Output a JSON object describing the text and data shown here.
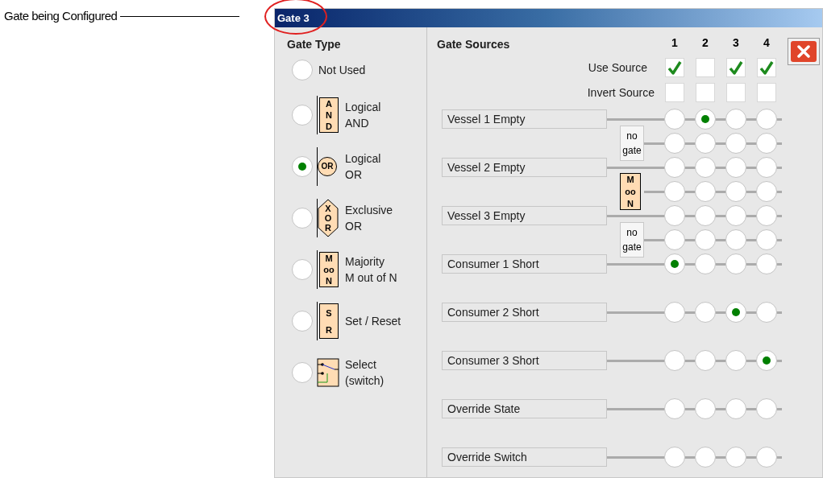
{
  "annotation": {
    "label": "Gate being Configured"
  },
  "window": {
    "title": "Gate 3"
  },
  "gate_type": {
    "heading": "Gate Type",
    "options": [
      {
        "label_lines": [
          "Not Used"
        ],
        "kind": "none",
        "selected": false
      },
      {
        "label_lines": [
          "Logical",
          "AND"
        ],
        "kind": "box",
        "symbol_lines": [
          "A",
          "N",
          "D"
        ],
        "selected": false
      },
      {
        "label_lines": [
          "Logical",
          "OR"
        ],
        "kind": "circle",
        "symbol_lines": [
          "OR"
        ],
        "selected": true
      },
      {
        "label_lines": [
          "Exclusive",
          "OR"
        ],
        "kind": "hexagon",
        "symbol_lines": [
          "X",
          "O",
          "R"
        ],
        "selected": false
      },
      {
        "label_lines": [
          "Majority",
          "M out of N"
        ],
        "kind": "box",
        "symbol_lines": [
          "M",
          "oo",
          "N"
        ],
        "selected": false
      },
      {
        "label_lines": [
          "Set / Reset"
        ],
        "kind": "box",
        "symbol_lines": [
          "S",
          "R"
        ],
        "selected": false
      },
      {
        "label_lines": [
          "Select",
          "(switch)"
        ],
        "kind": "switch",
        "selected": false
      }
    ]
  },
  "gate_sources": {
    "heading": "Gate Sources",
    "use_label": "Use Source",
    "invert_label": "Invert Source",
    "columns": [
      {
        "label": "1",
        "use": true,
        "invert": false
      },
      {
        "label": "2",
        "use": false,
        "invert": false
      },
      {
        "label": "3",
        "use": true,
        "invert": false
      },
      {
        "label": "4",
        "use": true,
        "invert": false
      }
    ],
    "rows": [
      {
        "kind": "source",
        "label": "Vessel 1 Empty",
        "slots": [
          {
            "selected": false
          },
          {
            "selected": true
          },
          {
            "selected": false
          },
          {
            "selected": false
          }
        ]
      },
      {
        "kind": "tag",
        "gate_label": "no gate",
        "slots": [
          {
            "selected": false
          },
          {
            "selected": false
          },
          {
            "selected": false
          },
          {
            "selected": false
          }
        ]
      },
      {
        "kind": "source",
        "label": "Vessel 2 Empty",
        "slots": [
          {
            "selected": false
          },
          {
            "selected": false
          },
          {
            "selected": false
          },
          {
            "selected": false
          }
        ]
      },
      {
        "kind": "symbol",
        "gate_lines": [
          "M",
          "oo",
          "N"
        ],
        "slots": [
          {
            "selected": false
          },
          {
            "selected": false
          },
          {
            "selected": false
          },
          {
            "selected": false
          }
        ]
      },
      {
        "kind": "source",
        "label": "Vessel 3 Empty",
        "slots": [
          {
            "selected": false
          },
          {
            "selected": false
          },
          {
            "selected": false
          },
          {
            "selected": false
          }
        ]
      },
      {
        "kind": "tag",
        "gate_label": "no gate",
        "slots": [
          {
            "selected": false
          },
          {
            "selected": false
          },
          {
            "selected": false
          },
          {
            "selected": false
          }
        ]
      },
      {
        "kind": "source",
        "label": "Consumer 1 Short",
        "slots": [
          {
            "selected": true
          },
          {
            "selected": false
          },
          {
            "selected": false
          },
          {
            "selected": false
          }
        ]
      },
      {
        "kind": "source",
        "label": "Consumer 2 Short",
        "slots": [
          {
            "selected": false
          },
          {
            "selected": false
          },
          {
            "selected": true
          },
          {
            "selected": false
          }
        ]
      },
      {
        "kind": "source",
        "label": "Consumer 3 Short",
        "slots": [
          {
            "selected": false
          },
          {
            "selected": false
          },
          {
            "selected": false
          },
          {
            "selected": true
          }
        ]
      },
      {
        "kind": "source",
        "label": "Override State",
        "slots": [
          {
            "selected": false
          },
          {
            "selected": false
          },
          {
            "selected": false
          },
          {
            "selected": false
          }
        ]
      },
      {
        "kind": "source",
        "label": "Override Switch",
        "slots": [
          {
            "selected": false
          },
          {
            "selected": false
          },
          {
            "selected": false
          },
          {
            "selected": false
          }
        ]
      }
    ]
  }
}
